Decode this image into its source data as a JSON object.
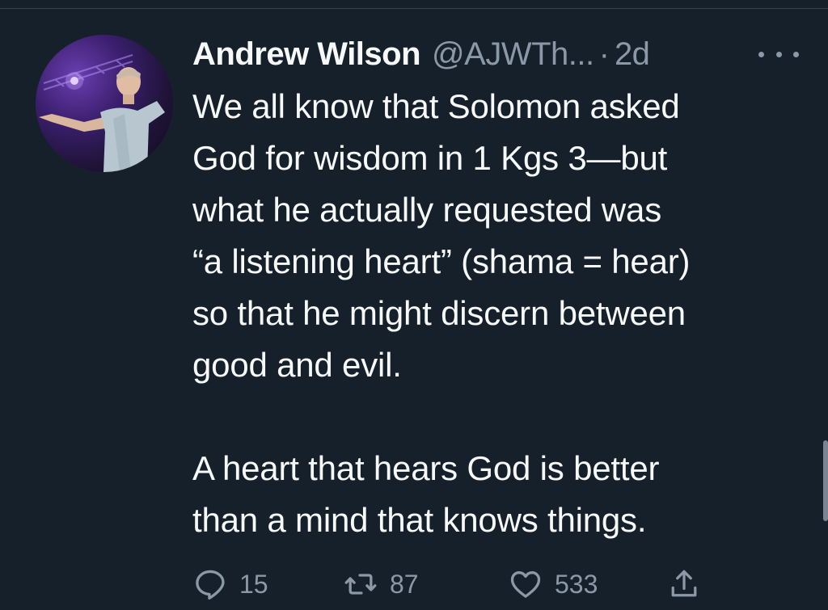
{
  "tweet": {
    "author": {
      "display_name": "Andrew Wilson",
      "handle": "@AJWTh...",
      "separator": "·",
      "time": "2d"
    },
    "text": {
      "paragraph_1_lines": [
        "We all know that Solomon asked",
        "God for wisdom in 1 Kgs 3—but",
        "what he actually requested was",
        "“a listening heart” (shama = hear)",
        "so that he might discern between",
        "good and evil."
      ],
      "paragraph_2_lines": [
        "A heart that hears God is better",
        "than a mind that knows things."
      ]
    },
    "actions": {
      "reply": {
        "icon": "reply-icon",
        "count": "15"
      },
      "retweet": {
        "icon": "retweet-icon",
        "count": "87"
      },
      "like": {
        "icon": "heart-icon",
        "count": "533"
      },
      "share": {
        "icon": "share-icon"
      }
    }
  },
  "colors": {
    "background": "#15202b",
    "text_primary": "#f7f9f9",
    "text_secondary": "#8b98a5",
    "divider": "#38444d"
  }
}
